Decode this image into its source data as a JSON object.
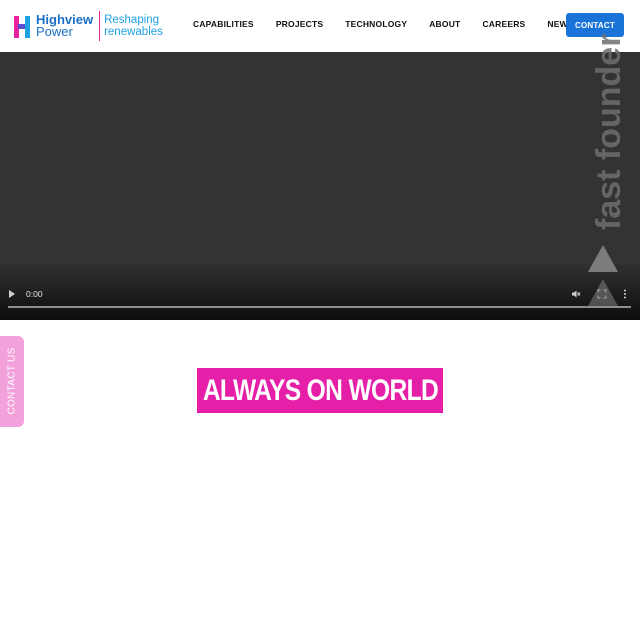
{
  "brand": {
    "name_line1": "Highview",
    "name_line2": "Power",
    "tagline_line1": "Reshaping",
    "tagline_line2": "renewables",
    "colors": {
      "pink": "#e6239c",
      "blue": "#1da1e2",
      "navy": "#1b6fc7"
    }
  },
  "nav": {
    "items": [
      "CAPABILITIES",
      "PROJECTS",
      "TECHNOLOGY",
      "ABOUT",
      "CAREERS",
      "NEWS"
    ],
    "contact_label": "CONTACT",
    "contact_color": "#1a73d9"
  },
  "video": {
    "time": "0:00",
    "background": "#333333",
    "controls": [
      "play-icon",
      "mute-icon",
      "fullscreen-icon",
      "more-options-icon"
    ]
  },
  "overlay": {
    "vertical_text": "fast founder"
  },
  "side_tab": {
    "label": "CONTACT US",
    "color": "#f2a1da"
  },
  "headline": {
    "text": "ALWAYS ON WORLD",
    "background": "#e61fa9"
  }
}
